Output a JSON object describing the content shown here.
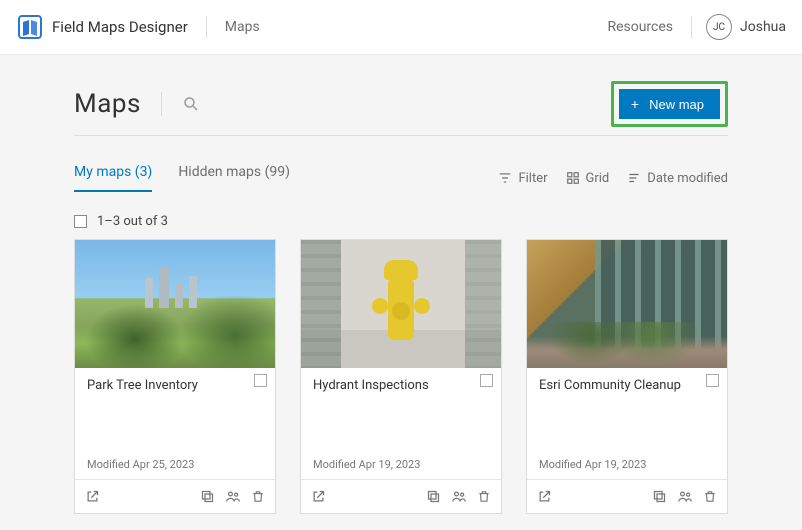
{
  "header": {
    "app_title": "Field Maps Designer",
    "nav_maps": "Maps",
    "resources": "Resources",
    "user_initials": "JC",
    "user_name": "Joshua"
  },
  "page": {
    "title": "Maps"
  },
  "actions": {
    "new_map": "New map"
  },
  "tabs": {
    "my_maps": "My maps (3)",
    "hidden_maps": "Hidden maps (99)"
  },
  "toolbar": {
    "filter": "Filter",
    "grid": "Grid",
    "sort": "Date modified"
  },
  "selection": {
    "count_label": "1–3 out of 3"
  },
  "cards": [
    {
      "title": "Park Tree Inventory",
      "modified": "Modified Apr 25, 2023"
    },
    {
      "title": "Hydrant Inspections",
      "modified": "Modified Apr 19, 2023"
    },
    {
      "title": "Esri Community Cleanup",
      "modified": "Modified Apr 19, 2023"
    }
  ]
}
